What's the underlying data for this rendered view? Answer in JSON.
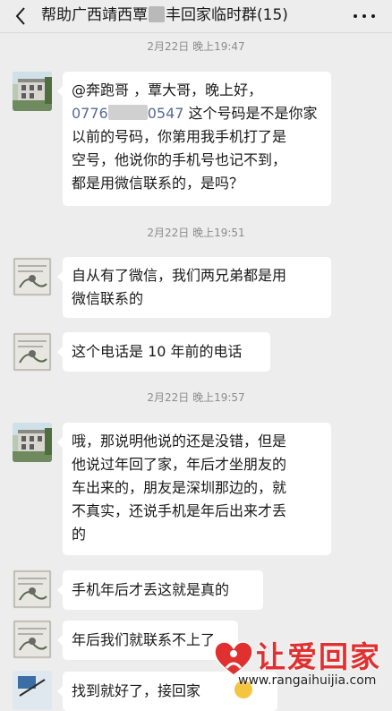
{
  "header": {
    "title_part1": "帮助广西靖西覃",
    "title_part2": "丰回家临时群(15)"
  },
  "timestamps": [
    "2月22日 晚上19:47",
    "2月22日 晚上19:51",
    "2月22日 晚上19:57"
  ],
  "messages": [
    {
      "sender": "user1",
      "lines": [
        "@奔跑哥 ，覃大哥，晚上好，",
        "这个号码是不是你家",
        "以前的号码，你第用我手机打了是",
        "空号，他说你的手机号也记不到，",
        "都是用微信联系的，是吗？"
      ],
      "phone_prefix": "0776",
      "phone_suffix": "0547"
    },
    {
      "sender": "user2",
      "lines": [
        "自从有了微信，我们两兄弟都是用",
        "微信联系的"
      ]
    },
    {
      "sender": "user2",
      "lines": [
        "这个电话是 10 年前的电话"
      ]
    },
    {
      "sender": "user1",
      "lines": [
        "哦，那说明他说的还是没错，但是",
        "他说过年回了家，年后才坐朋友的",
        "车出来的，朋友是深圳那边的，就",
        "不真实，还说手机是年后出来才丢",
        "的"
      ]
    },
    {
      "sender": "user2",
      "lines": [
        "手机年后才丢这就是真的"
      ]
    },
    {
      "sender": "user2",
      "lines": [
        "年后我们就联系不上了"
      ]
    },
    {
      "sender": "user3",
      "lines": [
        "找到就好了，接回家"
      ]
    }
  ],
  "watermark": {
    "brand": "让爱回家",
    "url": "www.rangaihuijia.com"
  },
  "colors": {
    "background": "#ededed",
    "bubble": "#ffffff",
    "link": "#576b95",
    "brand_red": "#e03030"
  }
}
